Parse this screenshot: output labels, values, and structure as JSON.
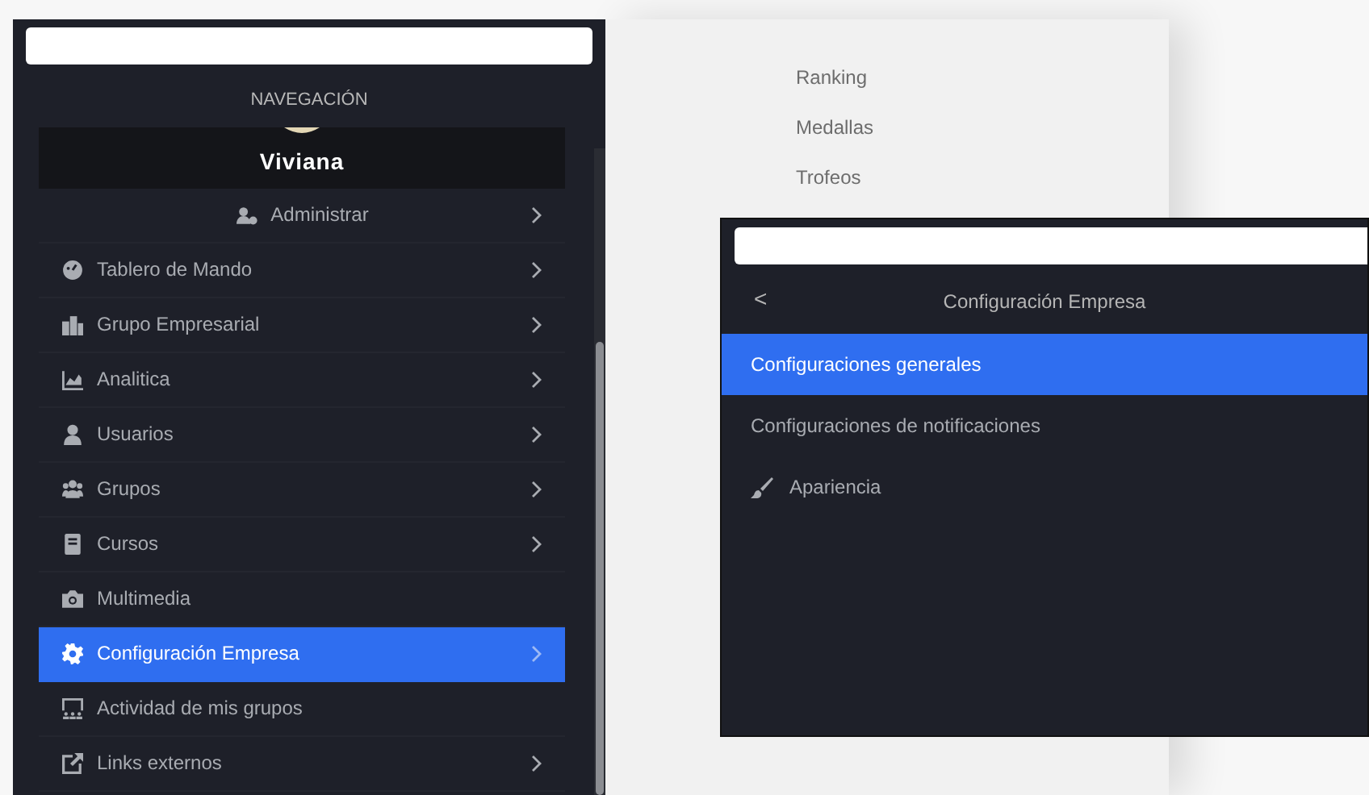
{
  "sidebar": {
    "heading": "NAVEGACIÓN",
    "user": {
      "name": "Viviana"
    },
    "items": [
      {
        "label": "Administrar",
        "kind": "centered",
        "chevron": true,
        "selected": false
      },
      {
        "label": "Tablero de Mando",
        "kind": "row",
        "chevron": true,
        "selected": false
      },
      {
        "label": "Grupo Empresarial",
        "kind": "row",
        "chevron": true,
        "selected": false
      },
      {
        "label": "Analitica",
        "kind": "row",
        "chevron": true,
        "selected": false
      },
      {
        "label": "Usuarios",
        "kind": "row",
        "chevron": true,
        "selected": false
      },
      {
        "label": "Grupos",
        "kind": "row",
        "chevron": true,
        "selected": false
      },
      {
        "label": "Cursos",
        "kind": "row",
        "chevron": true,
        "selected": false
      },
      {
        "label": "Multimedia",
        "kind": "row",
        "chevron": false,
        "selected": false
      },
      {
        "label": "Configuración Empresa",
        "kind": "row",
        "chevron": true,
        "selected": true
      },
      {
        "label": "Actividad de mis grupos",
        "kind": "row",
        "chevron": false,
        "selected": false
      },
      {
        "label": "Links externos",
        "kind": "row",
        "chevron": true,
        "selected": false
      }
    ]
  },
  "submenu": {
    "items": [
      "Ranking",
      "Medallas",
      "Trofeos"
    ]
  },
  "popup": {
    "back": "<",
    "title": "Configuración Empresa",
    "items": [
      {
        "label": "Configuraciones generales",
        "icon": false,
        "selected": true
      },
      {
        "label": "Configuraciones de notificaciones",
        "icon": false,
        "selected": false
      },
      {
        "label": "Apariencia",
        "icon": true,
        "selected": false
      }
    ]
  }
}
